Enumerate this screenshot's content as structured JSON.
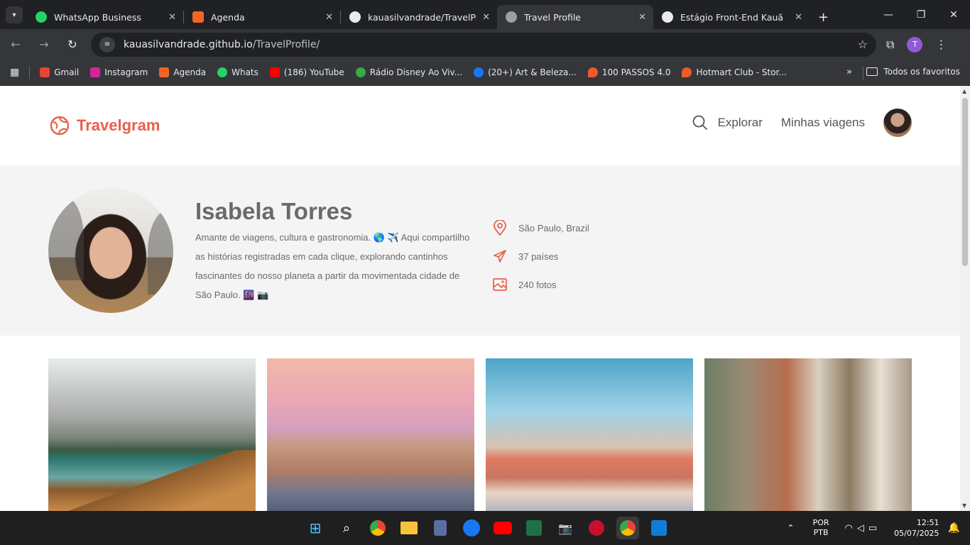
{
  "browser": {
    "tabs": [
      {
        "title": "WhatsApp Business",
        "color": "#25d366",
        "active": false
      },
      {
        "title": "Agenda",
        "color": "#f26522",
        "active": false
      },
      {
        "title": "kauasilvandrade/TravelProfile",
        "color": "#e8eaed",
        "active": false
      },
      {
        "title": "Travel Profile",
        "color": "#9aa0a6",
        "active": true
      },
      {
        "title": "Estágio Front-End Kauã",
        "color": "#e8eaed",
        "active": false
      }
    ],
    "url_host": "kauasilvandrade.github.io",
    "url_path": "/TravelProfile/",
    "profile_initial": "T",
    "bookmarks": [
      {
        "label": "Gmail",
        "color": "#ea4335"
      },
      {
        "label": "Instagram",
        "color": "#d6249f"
      },
      {
        "label": "Agenda",
        "color": "#f26522"
      },
      {
        "label": "Whats",
        "color": "#25d366"
      },
      {
        "label": "(186) YouTube",
        "color": "#ff0000"
      },
      {
        "label": "Rádio Disney Ao Viv...",
        "color": "#3aa845"
      },
      {
        "label": "(20+) Art & Beleza...",
        "color": "#1877f2"
      },
      {
        "label": "100 PASSOS 4.0",
        "color": "#f05a28"
      },
      {
        "label": "Hotmart Club - Stor...",
        "color": "#f05a28"
      }
    ],
    "all_bookmarks": "Todos os favoritos"
  },
  "site": {
    "logo": "Travelgram",
    "nav": {
      "explore": "Explorar",
      "trips": "Minhas viagens"
    },
    "accent": "#e8604c"
  },
  "profile": {
    "name": "Isabela Torres",
    "bio": "Amante de viagens, cultura e gastronomia. 🌎 ✈️ Aqui compartilho as histórias registradas em cada clique, explorando cantinhos fascinantes do nosso planeta a partir da movimentada cidade de São Paulo. 🌆 📷",
    "location": "São Paulo, Brazil",
    "countries": "37 países",
    "photos": "240 fotos"
  },
  "taskbar": {
    "lang1": "POR",
    "lang2": "PTB",
    "time": "12:51",
    "date": "05/07/2025"
  }
}
